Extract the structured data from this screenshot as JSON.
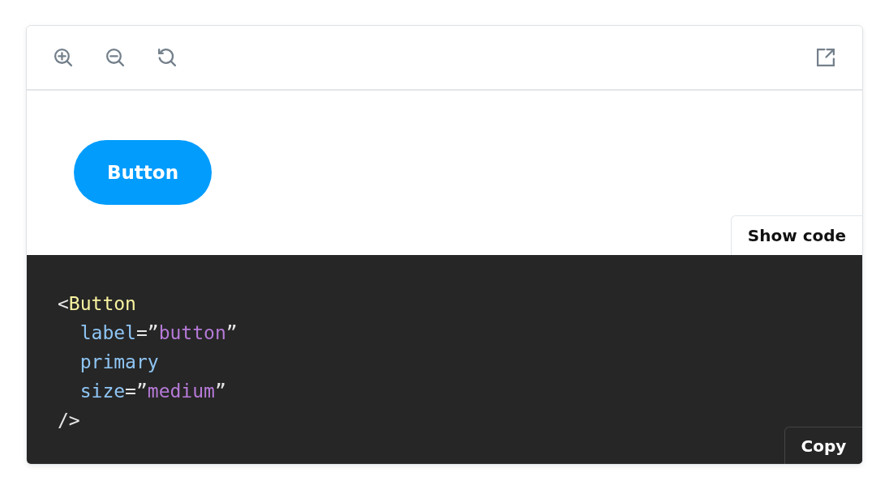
{
  "toolbar": {
    "tools": [
      {
        "kind": "zoom-in"
      },
      {
        "kind": "zoom-out"
      },
      {
        "kind": "reset"
      }
    ],
    "open_external": {
      "kind": "external"
    }
  },
  "preview": {
    "button": {
      "label": "Button"
    }
  },
  "show_code_tab": {
    "label": "Show code"
  },
  "code": {
    "lines": [
      [
        {
          "kind": "punct",
          "text": "<"
        },
        {
          "kind": "tag",
          "text": "Button"
        }
      ],
      [
        {
          "kind": "attr",
          "text": "  label"
        },
        {
          "kind": "punct",
          "text": "=”"
        },
        {
          "kind": "string",
          "text": "button"
        },
        {
          "kind": "punct",
          "text": "”"
        }
      ],
      [
        {
          "kind": "attr",
          "text": "  primary"
        }
      ],
      [
        {
          "kind": "attr",
          "text": "  size"
        },
        {
          "kind": "punct",
          "text": "=”"
        },
        {
          "kind": "string",
          "text": "medium"
        },
        {
          "kind": "punct",
          "text": "”"
        }
      ],
      [
        {
          "kind": "punct",
          "text": "/>"
        }
      ]
    ]
  },
  "copy_button": {
    "label": "Copy"
  }
}
